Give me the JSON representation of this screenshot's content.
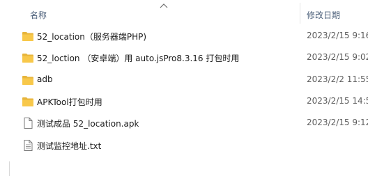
{
  "header": {
    "name_label": "名称",
    "date_label": "修改日期"
  },
  "files": [
    {
      "name": "52_location（服务器端PHP)",
      "date": "2023/2/15 9:16",
      "icon": "folder-icon"
    },
    {
      "name": "52_loction （安卓端）用 auto.jsPro8.3.16 打包时用",
      "date": "2023/2/15 9:02",
      "icon": "folder-icon"
    },
    {
      "name": "adb",
      "date": "2023/2/2 11:55",
      "icon": "folder-icon"
    },
    {
      "name": "APKTool打包时用",
      "date": "2023/2/15 14:5",
      "icon": "folder-icon"
    },
    {
      "name": "测试成品 52_location.apk",
      "date": "2023/2/15 9:12",
      "icon": "apk-file-icon"
    },
    {
      "name": "测试监控地址.txt",
      "date": "",
      "icon": "text-file-icon"
    }
  ],
  "colors": {
    "folder": "#f8c84a",
    "header_text": "#4c607a"
  }
}
